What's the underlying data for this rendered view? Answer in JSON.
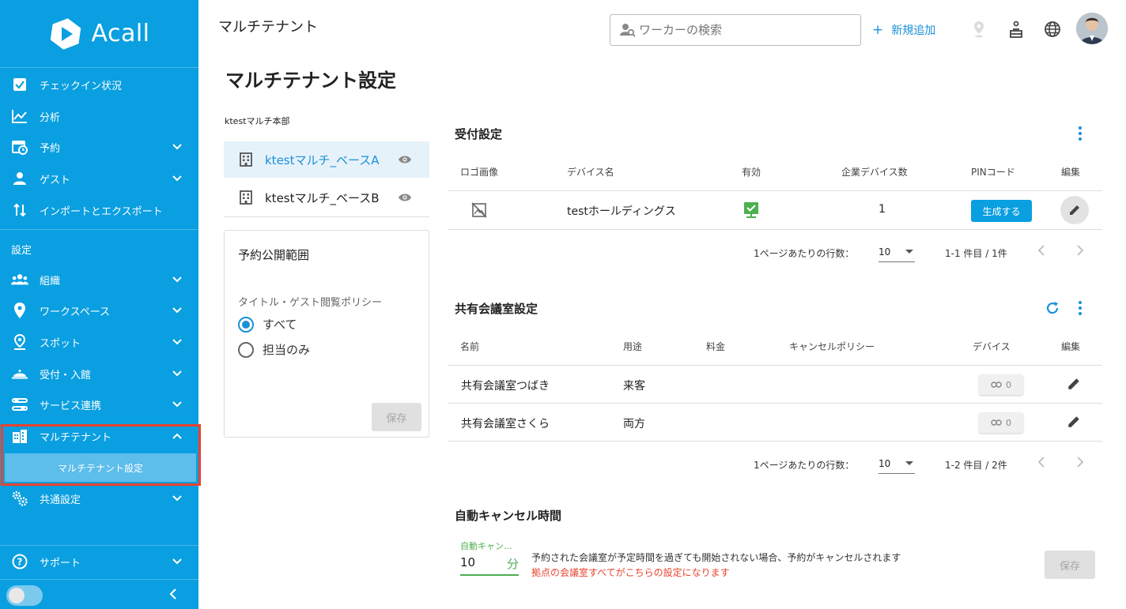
{
  "app": {
    "brand": "Acall"
  },
  "sidebar": {
    "items": [
      {
        "label": "チェックイン状況",
        "icon": "checkbox-icon",
        "chevron": ""
      },
      {
        "label": "分析",
        "icon": "chart-line-icon",
        "chevron": ""
      },
      {
        "label": "予約",
        "icon": "calendar-clock-icon",
        "chevron": "down"
      },
      {
        "label": "ゲスト",
        "icon": "guest-icon",
        "chevron": "down"
      },
      {
        "label": "インポートとエクスポート",
        "icon": "import-export-icon",
        "chevron": ""
      }
    ],
    "section_label": "設定",
    "settings_items": [
      {
        "label": "組織",
        "icon": "people-group-icon",
        "chevron": "down"
      },
      {
        "label": "ワークスペース",
        "icon": "location-pin-icon",
        "chevron": "down"
      },
      {
        "label": "スポット",
        "icon": "spot-pin-icon",
        "chevron": "down"
      },
      {
        "label": "受付・入館",
        "icon": "reception-bell-icon",
        "chevron": "down"
      },
      {
        "label": "サービス連携",
        "icon": "sliders-icon",
        "chevron": "down"
      },
      {
        "label": "マルチテナント",
        "icon": "building-icon",
        "chevron": "up"
      }
    ],
    "sub_item": "マルチテナント設定",
    "common_settings": {
      "label": "共通設定",
      "icon": "gears-icon"
    },
    "support": {
      "label": "サポート",
      "icon": "help-circle-icon"
    }
  },
  "topbar": {
    "title": "マルチテナント",
    "search_placeholder": "ワーカーの検索",
    "add_new": "新規追加"
  },
  "page": {
    "title": "マルチテナント設定",
    "org_label": "ktestマルチ本部",
    "tenants": [
      {
        "name": "ktestマルチ_ベースA",
        "active": true
      },
      {
        "name": "ktestマルチ_ベースB",
        "active": false
      }
    ],
    "publication": {
      "title": "予約公開範囲",
      "policy_label": "タイトル・ゲスト閲覧ポリシー",
      "options": [
        "すべて",
        "担当のみ"
      ],
      "selected": "すべて",
      "save": "保存"
    }
  },
  "reception": {
    "title": "受付設定",
    "headers": [
      "ロゴ画像",
      "デバイス名",
      "有効",
      "企業デバイス数",
      "PINコード",
      "編集"
    ],
    "row": {
      "device_name": "testホールディングス",
      "device_count": "1",
      "pin_button": "生成する"
    },
    "pager": {
      "rows_label": "1ページあたりの行数：",
      "rows_value": "10",
      "range": "1-1 件目 / 1件"
    }
  },
  "shared_rooms": {
    "title": "共有会議室設定",
    "headers": [
      "名前",
      "用途",
      "料金",
      "キャンセルポリシー",
      "デバイス",
      "編集"
    ],
    "rows": [
      {
        "name": "共有会議室つばき",
        "usage": "来客",
        "devices": "0"
      },
      {
        "name": "共有会議室さくら",
        "usage": "両方",
        "devices": "0"
      }
    ],
    "pager": {
      "rows_label": "1ページあたりの行数：",
      "rows_value": "10",
      "range": "1-2 件目 / 2件"
    }
  },
  "auto_cancel": {
    "title": "自動キャンセル時間",
    "field_label": "自動キャン...",
    "value": "10",
    "unit": "分",
    "description": "予約された会議室が予定時間を過ぎても開始されない場合、予約がキャンセルされます",
    "note": "拠点の会議室すべてがこちらの設定になります",
    "save": "保存"
  },
  "colors": {
    "brand": "#0a9fe0",
    "highlight": "#e8432e",
    "active_green": "#4caf50"
  }
}
